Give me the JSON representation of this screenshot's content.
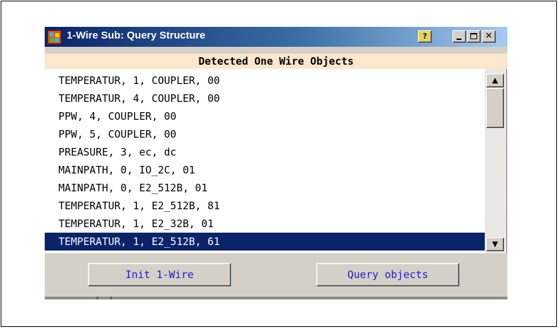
{
  "window": {
    "title": "1-Wire Sub: Query Structure",
    "icon": "app-icon",
    "controls": {
      "help": "?",
      "minimize": "minimize",
      "maximize": "maximize",
      "close": "✕"
    }
  },
  "header": {
    "label": "Detected One Wire Objects"
  },
  "list": {
    "items": [
      "TEMPERATUR, 1, COUPLER, 00",
      "TEMPERATUR, 4, COUPLER, 00",
      "PPW, 4, COUPLER, 00",
      "PPW, 5, COUPLER, 00",
      "PREASURE, 3, ec, dc",
      "MAINPATH, 0, IO_2C, 01",
      "MAINPATH, 0, E2_512B, 01",
      "TEMPERATUR, 1, E2_512B, 81",
      "TEMPERATUR, 1, E2_32B, 01",
      "TEMPERATUR, 1, E2_512B, 61"
    ],
    "selected_index": 9
  },
  "scrollbar": {
    "up_glyph": "▲",
    "down_glyph": "▼"
  },
  "buttons": {
    "init_label": "Init 1-Wire",
    "query_label": "Query objects"
  },
  "colors": {
    "title_gradient_start": "#0a246a",
    "header_background": "#fce6cc",
    "selection": "#0a246a",
    "button_text": "#1f1fd0"
  }
}
